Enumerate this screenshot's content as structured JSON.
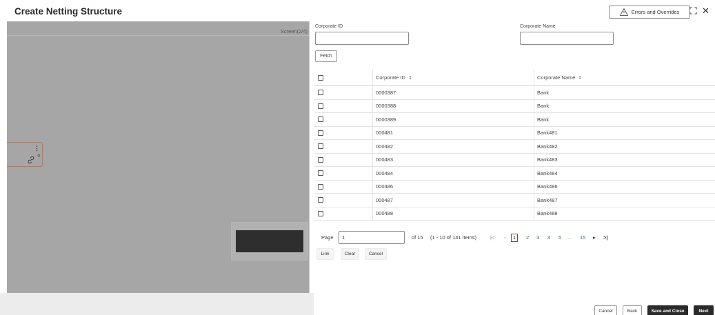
{
  "header": {
    "title": "Create Netting Structure",
    "errors_label": "Errors and Overrides"
  },
  "canvas": {
    "screen_label": "Screen(2/4)",
    "node_link_count": "0"
  },
  "form": {
    "corporate_id_label": "Corporate ID",
    "corporate_id_value": "",
    "corporate_name_label": "Corporate Name",
    "corporate_name_value": "",
    "fetch_label": "Fetch"
  },
  "grid": {
    "columns": [
      "Corporate ID",
      "Corporate Name"
    ],
    "rows": [
      {
        "id": "0000387",
        "name": "Bank"
      },
      {
        "id": "0000388",
        "name": "Bank"
      },
      {
        "id": "0000389",
        "name": "Bank"
      },
      {
        "id": "000481",
        "name": "Bank481"
      },
      {
        "id": "000482",
        "name": "Bank482"
      },
      {
        "id": "000483",
        "name": "Bank483"
      },
      {
        "id": "000484",
        "name": "Bank484"
      },
      {
        "id": "000486",
        "name": "Bank486"
      },
      {
        "id": "000487",
        "name": "Bank487"
      },
      {
        "id": "000488",
        "name": "Bank488"
      }
    ]
  },
  "pagination": {
    "page_label": "Page",
    "page_value": "1",
    "of_label": "of 15",
    "items_label": "(1 - 10 of 141 items)",
    "pages": [
      "1",
      "2",
      "3",
      "4",
      "5",
      "...",
      "15"
    ]
  },
  "actions": {
    "link": "Link",
    "clear": "Clear",
    "cancel": "Cancel"
  },
  "footer": {
    "cancel": "Cancel",
    "back": "Back",
    "save_close": "Save and Close",
    "next": "Next"
  }
}
